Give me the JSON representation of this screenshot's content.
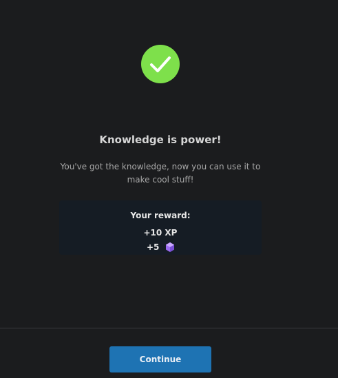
{
  "success": {
    "icon": "checkmark-icon",
    "icon_color": "#7ee04b"
  },
  "title": "Knowledge is power!",
  "subtitle": "You've got the knowledge, now you can use it to make cool stuff!",
  "reward": {
    "title": "Your reward:",
    "xp": "+10 XP",
    "gems_amount": "+5",
    "gem_icon": "gem-icon",
    "gem_color": "#9b6bf0"
  },
  "footer": {
    "continue_label": "Continue",
    "button_color": "#1e73b3"
  }
}
